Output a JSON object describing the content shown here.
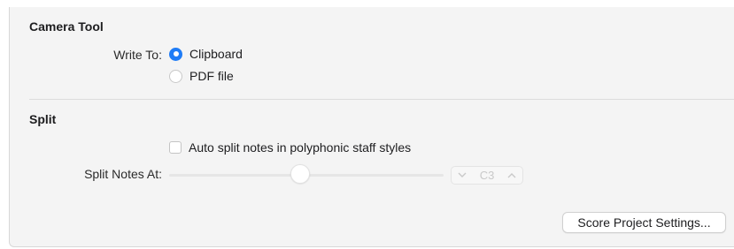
{
  "camera_tool": {
    "title": "Camera Tool",
    "write_to_label": "Write To:",
    "options": [
      {
        "label": "Clipboard",
        "selected": true
      },
      {
        "label": "PDF file",
        "selected": false
      }
    ]
  },
  "split": {
    "title": "Split",
    "auto_split_label": "Auto split notes in polyphonic staff styles",
    "auto_split_checked": false,
    "split_notes_at_label": "Split Notes At:",
    "stepper_value": "C3",
    "stepper_down_icon": "chevron-down-icon",
    "stepper_up_icon": "chevron-up-icon",
    "disabled": true
  },
  "footer": {
    "score_project_settings_label": "Score Project Settings..."
  },
  "colors": {
    "accent": "#1f7cf6",
    "panel_bg": "#f4f4f4",
    "disabled_text": "#c9c9c9"
  }
}
